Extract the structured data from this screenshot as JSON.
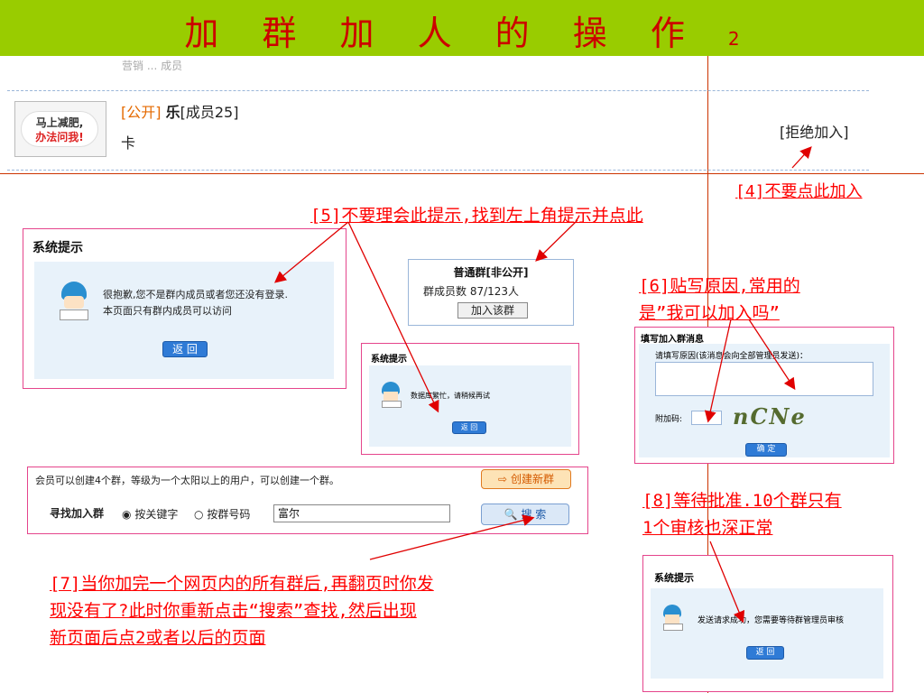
{
  "header": {
    "title": "加 群 加 人 的 操 作",
    "page_num": "2"
  },
  "group_row": {
    "partial_text": "营销 ... 成员",
    "avatar_line1": "马上减肥,",
    "avatar_line2": "办法问我!",
    "tag": "[公开]",
    "name": "乐",
    "members": "[成员25]",
    "sub": "卡",
    "reject": "[拒绝加入]"
  },
  "annotations": {
    "a4": "[4]不要点此加入",
    "a5": "[5]不要理会此提示,找到左上角提示并点此",
    "a6_line1": "[6]贴写原因,常用的",
    "a6_line2": "是”我可以加入吗”",
    "a7_line1": "[7]当你加完一个网页内的所有群后,再翻页时你发",
    "a7_line2": "现没有了?此时你重新点击“搜索”查找,然后出现",
    "a7_line3": "新页面后点2或者以后的页面",
    "a8_line1": "[8]等待批准.10个群只有",
    "a8_line2": "1个审核也深正常"
  },
  "dialog_left": {
    "title": "系统提示",
    "line1": "很抱歉,您不是群内成员或者您还没有登录.",
    "line2": "本页面只有群内成员可以访问",
    "button": "返 回"
  },
  "group_card": {
    "title": "普通群[非公开]",
    "count": "群成员数 87/123人",
    "button": "加入该群"
  },
  "dialog_busy": {
    "title": "系统提示",
    "text": "数据库繁忙，请稍候再试",
    "button": "返 回"
  },
  "join_form": {
    "title": "填写加入群消息",
    "reason_label": "请填写原因(该消息会向全部管理员发送)：",
    "captcha_label": "附加码:",
    "captcha_text": "nCNe",
    "confirm": "确 定"
  },
  "search_panel": {
    "info": "会员可以创建4个群，等级为一个太阳以上的用户，可以创建一个群。",
    "create_button": "创建新群",
    "find_label": "寻找加入群",
    "radio1": "按关键字",
    "radio2": "按群号码",
    "search_value": "富尔",
    "search_button": "搜 索"
  },
  "dialog_sent": {
    "title": "系统提示",
    "text": "发送请求成功，您需要等待群管理员审核",
    "button": "返 回"
  },
  "colors": {
    "topbar": "#99cc00",
    "title": "#cc0000",
    "annotation": "#ff0000",
    "border": "#e5458c",
    "panel": "#e8f2fa"
  }
}
